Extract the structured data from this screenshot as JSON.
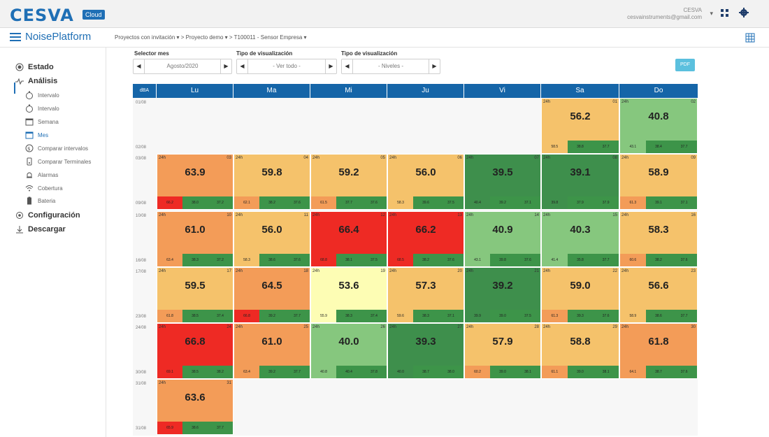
{
  "topbar": {
    "logo": "CESVA",
    "logo_badge": "Cloud",
    "user_name": "CESVA",
    "user_email": "cesvainstruments@gmail.com",
    "user_caret": "▾",
    "icons": [
      "grid-icon",
      "gear-icon"
    ]
  },
  "secbar": {
    "title": "NoisePlatform",
    "breadcrumb": "Proyectos con invitación ▾  >  Proyecto demo ▾  >  T100011 - Sensor Empresa ▾"
  },
  "sidebar": {
    "estado": "Estado",
    "analisis": "Análisis",
    "items": [
      {
        "label": "Intervalo",
        "icon": "stopwatch-icon"
      },
      {
        "label": "Intervalo",
        "icon": "stopwatch-icon"
      },
      {
        "label": "Semana",
        "icon": "calendar-icon"
      },
      {
        "label": "Mes",
        "icon": "calendar-icon"
      },
      {
        "label": "Comparar intervalos",
        "icon": "compare-icon"
      },
      {
        "label": "Comparar Terminales",
        "icon": "terminal-icon"
      },
      {
        "label": "Alarmas",
        "icon": "alarm-icon"
      },
      {
        "label": "Cobertura",
        "icon": "wifi-icon"
      },
      {
        "label": "Bateria",
        "icon": "battery-icon"
      }
    ],
    "configuracion": "Configuración",
    "descargar": "Descargar"
  },
  "selectors": [
    {
      "label": "Selector mes",
      "value": "Agosto/2020"
    },
    {
      "label": "Tipo de visualización",
      "value": "- Ver todo -"
    },
    {
      "label": "Tipo de visualización",
      "value": "- Niveles -"
    }
  ],
  "pdf_label": "PDF",
  "calendar": {
    "corner": "dBA",
    "day_names": [
      "Lu",
      "Ma",
      "Mi",
      "Ju",
      "Vi",
      "Sa",
      "Do"
    ],
    "day_tag": "24h",
    "colors": {
      "red": "#ee2a24",
      "orange": "#f39c58",
      "lightorange": "#f5c26b",
      "yellow": "#fdfdb4",
      "lightgreen": "#86c77e",
      "darkgreen": "#3e8f4c",
      "sub_green": "#3d9449"
    },
    "weeks": [
      {
        "start": "01/08",
        "end": "02/08"
      },
      {
        "start": "03/08",
        "end": "09/08"
      },
      {
        "start": "10/08",
        "end": "16/08"
      },
      {
        "start": "17/08",
        "end": "23/08"
      },
      {
        "start": "24/08",
        "end": "30/08"
      },
      {
        "start": "31/08",
        "end": "31/08"
      }
    ],
    "days": [
      {
        "n": "01",
        "week": 0,
        "col": 5,
        "main": "56.2",
        "c": "lightorange",
        "sub": [
          "58.5",
          "38.8",
          "37.7"
        ],
        "s0": "lightorange"
      },
      {
        "n": "02",
        "week": 0,
        "col": 6,
        "main": "40.8",
        "c": "lightgreen",
        "sub": [
          "43.1",
          "38.4",
          "37.7"
        ],
        "s0": "lightgreen"
      },
      {
        "n": "03",
        "week": 1,
        "col": 0,
        "main": "63.9",
        "c": "orange",
        "sub": [
          "66.2",
          "38.0",
          "37.2"
        ],
        "s0": "red"
      },
      {
        "n": "04",
        "week": 1,
        "col": 1,
        "main": "59.8",
        "c": "lightorange",
        "sub": [
          "62.1",
          "38.2",
          "37.6"
        ],
        "s0": "orange"
      },
      {
        "n": "05",
        "week": 1,
        "col": 2,
        "main": "59.2",
        "c": "lightorange",
        "sub": [
          "61.5",
          "37.7",
          "37.6"
        ],
        "s0": "orange"
      },
      {
        "n": "06",
        "week": 1,
        "col": 3,
        "main": "56.0",
        "c": "lightorange",
        "sub": [
          "58.3",
          "39.6",
          "37.5"
        ],
        "s0": "lightorange"
      },
      {
        "n": "07",
        "week": 1,
        "col": 4,
        "main": "39.5",
        "c": "darkgreen",
        "sub": [
          "40.4",
          "39.2",
          "37.1"
        ],
        "s0": "darkgreen"
      },
      {
        "n": "08",
        "week": 1,
        "col": 5,
        "main": "39.1",
        "c": "darkgreen",
        "sub": [
          "39.8",
          "37.9",
          "37.9"
        ],
        "s0": "darkgreen"
      },
      {
        "n": "09",
        "week": 1,
        "col": 6,
        "main": "58.9",
        "c": "lightorange",
        "sub": [
          "61.3",
          "39.1",
          "37.1"
        ],
        "s0": "orange"
      },
      {
        "n": "10",
        "week": 2,
        "col": 0,
        "main": "61.0",
        "c": "orange",
        "sub": [
          "63.4",
          "38.3",
          "37.2"
        ],
        "s0": "orange"
      },
      {
        "n": "11",
        "week": 2,
        "col": 1,
        "main": "56.0",
        "c": "lightorange",
        "sub": [
          "58.3",
          "38.6",
          "37.6"
        ],
        "s0": "lightorange"
      },
      {
        "n": "12",
        "week": 2,
        "col": 2,
        "main": "66.4",
        "c": "red",
        "sub": [
          "68.8",
          "38.1",
          "37.5"
        ],
        "s0": "red"
      },
      {
        "n": "13",
        "week": 2,
        "col": 3,
        "main": "66.2",
        "c": "red",
        "sub": [
          "68.5",
          "38.2",
          "37.6"
        ],
        "s0": "red"
      },
      {
        "n": "14",
        "week": 2,
        "col": 4,
        "main": "40.9",
        "c": "lightgreen",
        "sub": [
          "43.1",
          "39.8",
          "37.6"
        ],
        "s0": "lightgreen"
      },
      {
        "n": "15",
        "week": 2,
        "col": 5,
        "main": "40.3",
        "c": "lightgreen",
        "sub": [
          "41.4",
          "35.8",
          "37.7"
        ],
        "s0": "lightgreen"
      },
      {
        "n": "16",
        "week": 2,
        "col": 6,
        "main": "58.3",
        "c": "lightorange",
        "sub": [
          "60.6",
          "38.2",
          "37.6"
        ],
        "s0": "orange"
      },
      {
        "n": "17",
        "week": 3,
        "col": 0,
        "main": "59.5",
        "c": "lightorange",
        "sub": [
          "61.8",
          "38.5",
          "37.4"
        ],
        "s0": "orange"
      },
      {
        "n": "18",
        "week": 3,
        "col": 1,
        "main": "64.5",
        "c": "orange",
        "sub": [
          "66.8",
          "39.2",
          "37.7"
        ],
        "s0": "red"
      },
      {
        "n": "19",
        "week": 3,
        "col": 2,
        "main": "53.6",
        "c": "yellow",
        "sub": [
          "55.9",
          "38.3",
          "37.4"
        ],
        "s0": "yellow"
      },
      {
        "n": "20",
        "week": 3,
        "col": 3,
        "main": "57.3",
        "c": "lightorange",
        "sub": [
          "59.6",
          "38.3",
          "37.1"
        ],
        "s0": "lightorange"
      },
      {
        "n": "21",
        "week": 3,
        "col": 4,
        "main": "39.2",
        "c": "darkgreen",
        "sub": [
          "39.9",
          "39.0",
          "37.5"
        ],
        "s0": "darkgreen"
      },
      {
        "n": "22",
        "week": 3,
        "col": 5,
        "main": "59.0",
        "c": "lightorange",
        "sub": [
          "61.3",
          "39.3",
          "37.6"
        ],
        "s0": "orange"
      },
      {
        "n": "23",
        "week": 3,
        "col": 6,
        "main": "56.6",
        "c": "lightorange",
        "sub": [
          "58.9",
          "38.6",
          "37.7"
        ],
        "s0": "lightorange"
      },
      {
        "n": "24",
        "week": 4,
        "col": 0,
        "main": "66.8",
        "c": "red",
        "sub": [
          "69.1",
          "38.5",
          "38.2"
        ],
        "s0": "red"
      },
      {
        "n": "25",
        "week": 4,
        "col": 1,
        "main": "61.0",
        "c": "orange",
        "sub": [
          "63.4",
          "39.2",
          "37.7"
        ],
        "s0": "orange"
      },
      {
        "n": "26",
        "week": 4,
        "col": 2,
        "main": "40.0",
        "c": "lightgreen",
        "sub": [
          "40.8",
          "40.4",
          "37.8"
        ],
        "s0": "lightgreen"
      },
      {
        "n": "27",
        "week": 4,
        "col": 3,
        "main": "39.3",
        "c": "darkgreen",
        "sub": [
          "40.0",
          "38.7",
          "38.0"
        ],
        "s0": "darkgreen"
      },
      {
        "n": "28",
        "week": 4,
        "col": 4,
        "main": "57.9",
        "c": "lightorange",
        "sub": [
          "60.2",
          "39.0",
          "38.1"
        ],
        "s0": "orange"
      },
      {
        "n": "29",
        "week": 4,
        "col": 5,
        "main": "58.8",
        "c": "lightorange",
        "sub": [
          "61.1",
          "39.0",
          "38.1"
        ],
        "s0": "orange"
      },
      {
        "n": "30",
        "week": 4,
        "col": 6,
        "main": "61.8",
        "c": "orange",
        "sub": [
          "64.1",
          "38.7",
          "37.6"
        ],
        "s0": "orange"
      },
      {
        "n": "31",
        "week": 5,
        "col": 0,
        "main": "63.6",
        "c": "orange",
        "sub": [
          "65.9",
          "38.6",
          "37.7"
        ],
        "s0": "red"
      }
    ]
  }
}
